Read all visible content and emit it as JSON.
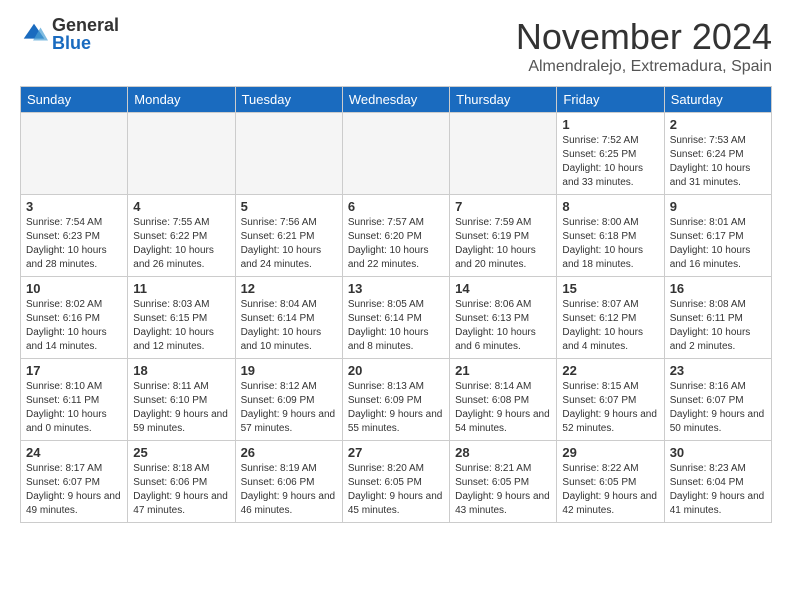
{
  "logo": {
    "general": "General",
    "blue": "Blue"
  },
  "title": "November 2024",
  "location": "Almendralejo, Extremadura, Spain",
  "days_header": [
    "Sunday",
    "Monday",
    "Tuesday",
    "Wednesday",
    "Thursday",
    "Friday",
    "Saturday"
  ],
  "weeks": [
    [
      {
        "num": "",
        "info": "",
        "empty": true
      },
      {
        "num": "",
        "info": "",
        "empty": true
      },
      {
        "num": "",
        "info": "",
        "empty": true
      },
      {
        "num": "",
        "info": "",
        "empty": true
      },
      {
        "num": "",
        "info": "",
        "empty": true
      },
      {
        "num": "1",
        "info": "Sunrise: 7:52 AM\nSunset: 6:25 PM\nDaylight: 10 hours and 33 minutes."
      },
      {
        "num": "2",
        "info": "Sunrise: 7:53 AM\nSunset: 6:24 PM\nDaylight: 10 hours and 31 minutes."
      }
    ],
    [
      {
        "num": "3",
        "info": "Sunrise: 7:54 AM\nSunset: 6:23 PM\nDaylight: 10 hours and 28 minutes."
      },
      {
        "num": "4",
        "info": "Sunrise: 7:55 AM\nSunset: 6:22 PM\nDaylight: 10 hours and 26 minutes."
      },
      {
        "num": "5",
        "info": "Sunrise: 7:56 AM\nSunset: 6:21 PM\nDaylight: 10 hours and 24 minutes."
      },
      {
        "num": "6",
        "info": "Sunrise: 7:57 AM\nSunset: 6:20 PM\nDaylight: 10 hours and 22 minutes."
      },
      {
        "num": "7",
        "info": "Sunrise: 7:59 AM\nSunset: 6:19 PM\nDaylight: 10 hours and 20 minutes."
      },
      {
        "num": "8",
        "info": "Sunrise: 8:00 AM\nSunset: 6:18 PM\nDaylight: 10 hours and 18 minutes."
      },
      {
        "num": "9",
        "info": "Sunrise: 8:01 AM\nSunset: 6:17 PM\nDaylight: 10 hours and 16 minutes."
      }
    ],
    [
      {
        "num": "10",
        "info": "Sunrise: 8:02 AM\nSunset: 6:16 PM\nDaylight: 10 hours and 14 minutes."
      },
      {
        "num": "11",
        "info": "Sunrise: 8:03 AM\nSunset: 6:15 PM\nDaylight: 10 hours and 12 minutes."
      },
      {
        "num": "12",
        "info": "Sunrise: 8:04 AM\nSunset: 6:14 PM\nDaylight: 10 hours and 10 minutes."
      },
      {
        "num": "13",
        "info": "Sunrise: 8:05 AM\nSunset: 6:14 PM\nDaylight: 10 hours and 8 minutes."
      },
      {
        "num": "14",
        "info": "Sunrise: 8:06 AM\nSunset: 6:13 PM\nDaylight: 10 hours and 6 minutes."
      },
      {
        "num": "15",
        "info": "Sunrise: 8:07 AM\nSunset: 6:12 PM\nDaylight: 10 hours and 4 minutes."
      },
      {
        "num": "16",
        "info": "Sunrise: 8:08 AM\nSunset: 6:11 PM\nDaylight: 10 hours and 2 minutes."
      }
    ],
    [
      {
        "num": "17",
        "info": "Sunrise: 8:10 AM\nSunset: 6:11 PM\nDaylight: 10 hours and 0 minutes."
      },
      {
        "num": "18",
        "info": "Sunrise: 8:11 AM\nSunset: 6:10 PM\nDaylight: 9 hours and 59 minutes."
      },
      {
        "num": "19",
        "info": "Sunrise: 8:12 AM\nSunset: 6:09 PM\nDaylight: 9 hours and 57 minutes."
      },
      {
        "num": "20",
        "info": "Sunrise: 8:13 AM\nSunset: 6:09 PM\nDaylight: 9 hours and 55 minutes."
      },
      {
        "num": "21",
        "info": "Sunrise: 8:14 AM\nSunset: 6:08 PM\nDaylight: 9 hours and 54 minutes."
      },
      {
        "num": "22",
        "info": "Sunrise: 8:15 AM\nSunset: 6:07 PM\nDaylight: 9 hours and 52 minutes."
      },
      {
        "num": "23",
        "info": "Sunrise: 8:16 AM\nSunset: 6:07 PM\nDaylight: 9 hours and 50 minutes."
      }
    ],
    [
      {
        "num": "24",
        "info": "Sunrise: 8:17 AM\nSunset: 6:07 PM\nDaylight: 9 hours and 49 minutes."
      },
      {
        "num": "25",
        "info": "Sunrise: 8:18 AM\nSunset: 6:06 PM\nDaylight: 9 hours and 47 minutes."
      },
      {
        "num": "26",
        "info": "Sunrise: 8:19 AM\nSunset: 6:06 PM\nDaylight: 9 hours and 46 minutes."
      },
      {
        "num": "27",
        "info": "Sunrise: 8:20 AM\nSunset: 6:05 PM\nDaylight: 9 hours and 45 minutes."
      },
      {
        "num": "28",
        "info": "Sunrise: 8:21 AM\nSunset: 6:05 PM\nDaylight: 9 hours and 43 minutes."
      },
      {
        "num": "29",
        "info": "Sunrise: 8:22 AM\nSunset: 6:05 PM\nDaylight: 9 hours and 42 minutes."
      },
      {
        "num": "30",
        "info": "Sunrise: 8:23 AM\nSunset: 6:04 PM\nDaylight: 9 hours and 41 minutes."
      }
    ]
  ]
}
